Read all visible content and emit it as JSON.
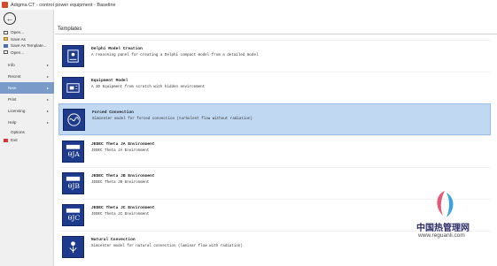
{
  "window": {
    "title": "Adigma CT - control power equipment - Baseline"
  },
  "sidebar": {
    "back_icon": "back-arrow-icon",
    "file_items": [
      {
        "label": "Open...",
        "icon": "new-document-icon"
      },
      {
        "label": "Save As",
        "icon": "open-folder-icon"
      },
      {
        "label": "Save As Template...",
        "icon": "save-template-icon"
      },
      {
        "label": "Open...",
        "icon": "open-file-icon"
      }
    ],
    "sections": [
      {
        "label": "Info",
        "arrow": "▸"
      },
      {
        "label": "Recent",
        "arrow": "▸"
      },
      {
        "label": "New",
        "arrow": "▸",
        "active": true
      },
      {
        "label": "Print",
        "arrow": "▸"
      },
      {
        "label": "Licensing",
        "arrow": "▸"
      },
      {
        "label": "Help",
        "arrow": "▸"
      }
    ],
    "options_label": "Options",
    "quit_label": "Exit"
  },
  "main": {
    "heading": "Templates",
    "templates": [
      {
        "name": "Delphi Model Creation",
        "desc": "A reasoning panel for creating a Delphi compact model from a detailed model",
        "icon": "delphi-model-icon"
      },
      {
        "name": "Equipment Model",
        "desc": "A 3D Equipment from scratch with hidden environment",
        "icon": "equipment-model-icon"
      },
      {
        "name": "Forced Convection",
        "desc": "Simcenter model for forced convection (turbulent flow without radiation)",
        "icon": "forced-convection-icon",
        "selected": true
      },
      {
        "name": "JEDEC Theta JA Environment",
        "desc": "JEDEC Theta JA Environment",
        "icon": "theta-ja-icon",
        "symbol": "θJA"
      },
      {
        "name": "JEDEC Theta JB Environment",
        "desc": "JEDEC Theta JB Environment",
        "icon": "theta-jb-icon",
        "symbol": "θJB"
      },
      {
        "name": "JEDEC Theta JC Environment",
        "desc": "JEDEC Theta JC Environment",
        "icon": "theta-jc-icon",
        "symbol": "θJC"
      },
      {
        "name": "Natural Convection",
        "desc": "Simcenter model for natural convection (laminar flow with radiation)",
        "icon": "natural-convection-icon"
      }
    ]
  },
  "watermark": {
    "cn_text": "中国热管理网",
    "url": "www.reguanli.com"
  },
  "colors": {
    "accent_active": "#7a9bc9",
    "selected_row": "#c1d8f2",
    "template_icon_bg": "#1d3a8c"
  }
}
